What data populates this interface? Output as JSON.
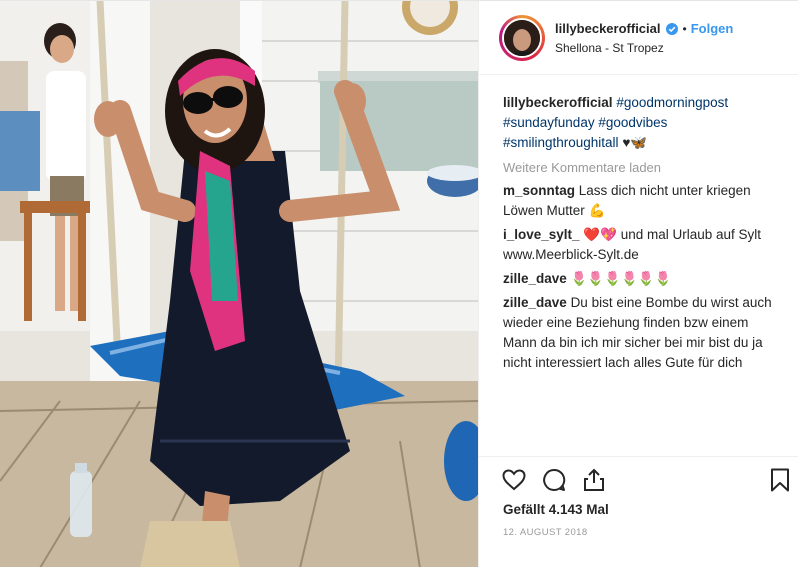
{
  "post": {
    "username": "lillybeckerofficial",
    "follow_label": "Folgen",
    "separator": "•",
    "location": "Shellona - St Tropez"
  },
  "caption": {
    "username": "lillybeckerofficial",
    "tags": [
      "#goodmorningpost",
      "#sundayfunday",
      "#goodvibes",
      "#smilingthroughitall"
    ],
    "emoji": "♥🦋"
  },
  "load_more": "Weitere Kommentare laden",
  "comments": [
    {
      "username": "m_sonntag",
      "text": "Lass dich nicht unter kriegen Löwen Mutter 💪"
    },
    {
      "username": "i_love_sylt_",
      "text": "❤️💖 und mal Urlaub auf Sylt www.Meerblick-Sylt.de"
    },
    {
      "username": "zille_dave",
      "text": "🌷🌷🌷🌷🌷🌷"
    },
    {
      "username": "zille_dave",
      "text": "Du bist eine Bombe du wirst auch wieder eine Beziehung finden bzw einem Mann da bin ich mir sicher bei mir bist du ja nicht interessiert lach alles Gute für dich"
    }
  ],
  "likes": "Gefällt 4.143 Mal",
  "date": "12. AUGUST 2018",
  "icons": {
    "like": "heart-icon",
    "comment": "comment-icon",
    "share": "share-icon",
    "save": "bookmark-icon",
    "verified": "verified-badge-icon",
    "comment_like": "heart-icon"
  },
  "colors": {
    "follow": "#3897f0",
    "hashtag": "#003569",
    "muted": "#999999",
    "text": "#262626"
  }
}
